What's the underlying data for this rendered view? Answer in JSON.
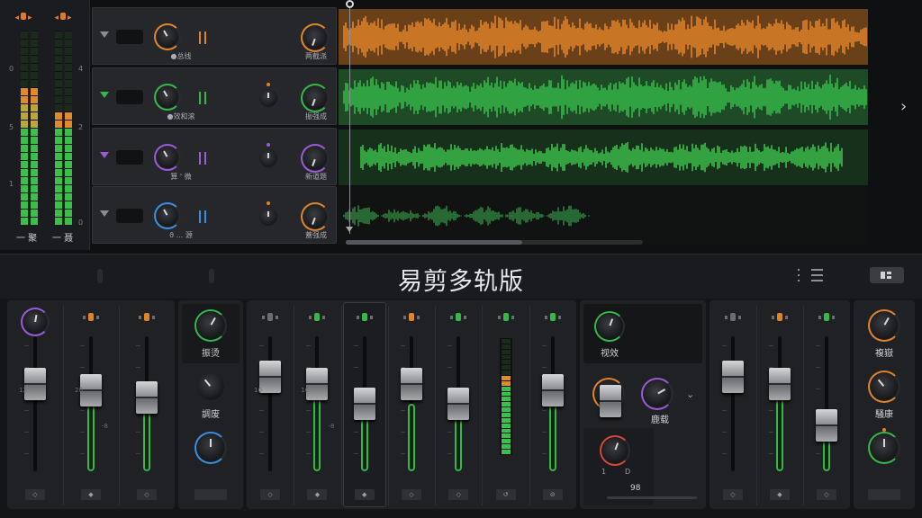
{
  "app": {
    "title": "易剪多轨版"
  },
  "master_meters": {
    "left_label": "一 聚",
    "right_label": "一 聂",
    "scale": [
      "0",
      "5",
      "1"
    ],
    "scale_right": [
      "4",
      "2",
      "0"
    ],
    "left_level": 0.72,
    "right_level": 0.61
  },
  "tracks": [
    {
      "name": "●总线",
      "send_label": "两截派",
      "color": "#e0842a",
      "wave_color": "#e0842a",
      "lane_bg": "#6a4018",
      "peak": 0.78
    },
    {
      "name": "●效和滚",
      "send_label": "振强成",
      "color": "#35b84a",
      "wave_color": "#35b84a",
      "lane_bg": "#1f4a26",
      "peak": 0.82
    },
    {
      "name": "算 ' 微",
      "send_label": "新道题",
      "color": "#9b5bd6",
      "wave_color": "#3cbf4a",
      "lane_bg": "#17301b",
      "peak": 0.55
    },
    {
      "name": "ϑ ... 源",
      "send_label": "蓋强成",
      "color": "#3a8fe0",
      "wave_color": "#2f7f3c",
      "lane_bg": "#111313",
      "peak": 0.42
    }
  ],
  "mixer": {
    "groups": [
      {
        "channels": [
          {
            "knob_color": "#9b5bd6",
            "header_color": null,
            "fader_pos": 0.35,
            "fill": 0.0,
            "foot": "◇",
            "scale": [
              "12"
            ]
          },
          {
            "header_color": "#e0842a",
            "fader_pos": 0.4,
            "fill": 0.55,
            "foot": "◆",
            "scale": [
              "20",
              "-8"
            ]
          },
          {
            "header_color": "#e0842a",
            "fader_pos": 0.45,
            "fill": 0.5,
            "foot": "◇"
          }
        ]
      },
      {
        "knobs": [
          {
            "label": "振烫",
            "ring": "#35b84a"
          },
          {
            "label": "調废",
            "ring": null
          },
          {
            "label": "",
            "ring": "#3a8fe0"
          }
        ]
      },
      {
        "channels": [
          {
            "header_color": "#6a6d72",
            "fader_pos": 0.3,
            "fill": 0.0,
            "foot": "◇",
            "scale": [
              "10"
            ]
          },
          {
            "header_color": "#35b84a",
            "fader_pos": 0.35,
            "fill": 0.55,
            "foot": "◆",
            "scale": [
              "10",
              "-8"
            ]
          },
          {
            "header_color": "#35b84a",
            "fader_pos": 0.5,
            "fill": 0.45,
            "foot": "◆",
            "selected": true
          },
          {
            "header_color": "#e0842a",
            "fader_pos": 0.35,
            "fill": 0.5,
            "foot": "◇"
          },
          {
            "header_color": "#35b84a",
            "fader_pos": 0.5,
            "fill": 0.45,
            "foot": "◇"
          },
          {
            "header_color": "#35b84a",
            "vu": true,
            "level": 0.7,
            "foot": "↺"
          },
          {
            "header_color": "#35b84a",
            "fader_pos": 0.4,
            "fill": 0.55,
            "foot": "⊘"
          }
        ]
      },
      {
        "fx": {
          "top_label": "视效",
          "bottom_label": "鹿载",
          "readout": "98",
          "mini_left": "1",
          "mini_right": "D"
        }
      },
      {
        "channels": [
          {
            "header_color": "#6a6d72",
            "fader_pos": 0.3,
            "fill": 0.0,
            "foot": "◇"
          },
          {
            "header_color": "#e0842a",
            "fader_pos": 0.35,
            "fill": 0.55,
            "foot": "◆"
          },
          {
            "header_color": "#35b84a",
            "fader_pos": 0.66,
            "fill": 0.25,
            "foot": "◇"
          }
        ]
      },
      {
        "knobs": [
          {
            "label": "複嶽",
            "ring": "#e0842a"
          },
          {
            "label": "騒康",
            "ring": "#e0842a"
          },
          {
            "label": "",
            "ring": "#35b84a"
          }
        ]
      }
    ]
  },
  "colors": {
    "accent_orange": "#e0842a",
    "accent_green": "#35b84a",
    "accent_purple": "#9b5bd6",
    "accent_blue": "#3a8fe0"
  },
  "icons": [
    "playhead-icon",
    "chevron-right-icon",
    "list-icon",
    "panel-icon",
    "chevron-down-icon",
    "collapse-triangle-icon"
  ]
}
